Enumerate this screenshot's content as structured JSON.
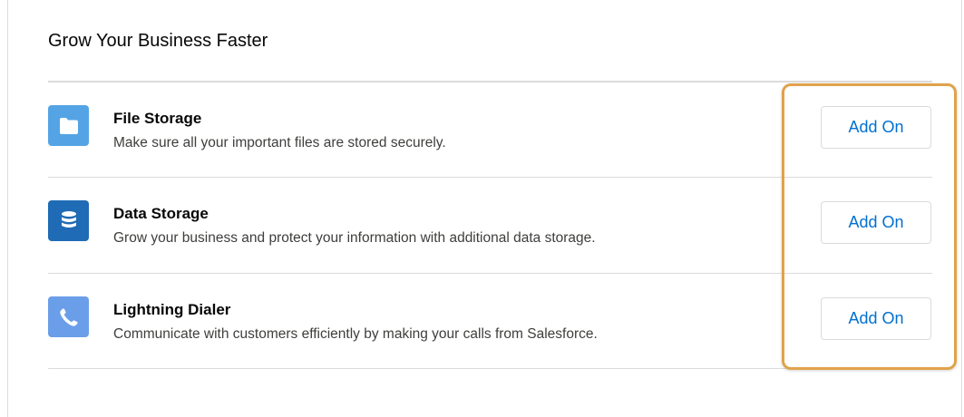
{
  "card": {
    "title": "Grow Your Business Faster"
  },
  "items": [
    {
      "title": "File Storage",
      "description": "Make sure all your important files are stored securely.",
      "icon": "folder-icon",
      "icon_color": "#54a4e5",
      "button_label": "Add On"
    },
    {
      "title": "Data Storage",
      "description": "Grow your business and protect your information with additional data storage.",
      "icon": "database-icon",
      "icon_color": "#1f6bb5",
      "button_label": "Add On"
    },
    {
      "title": "Lightning Dialer",
      "description": "Communicate with customers efficiently by making your calls from Salesforce.",
      "icon": "phone-icon",
      "icon_color": "#6b9ee8",
      "button_label": "Add On"
    }
  ],
  "colors": {
    "button_text": "#0070d2",
    "highlight_border": "#e0a24a",
    "divider": "#dddbda"
  }
}
